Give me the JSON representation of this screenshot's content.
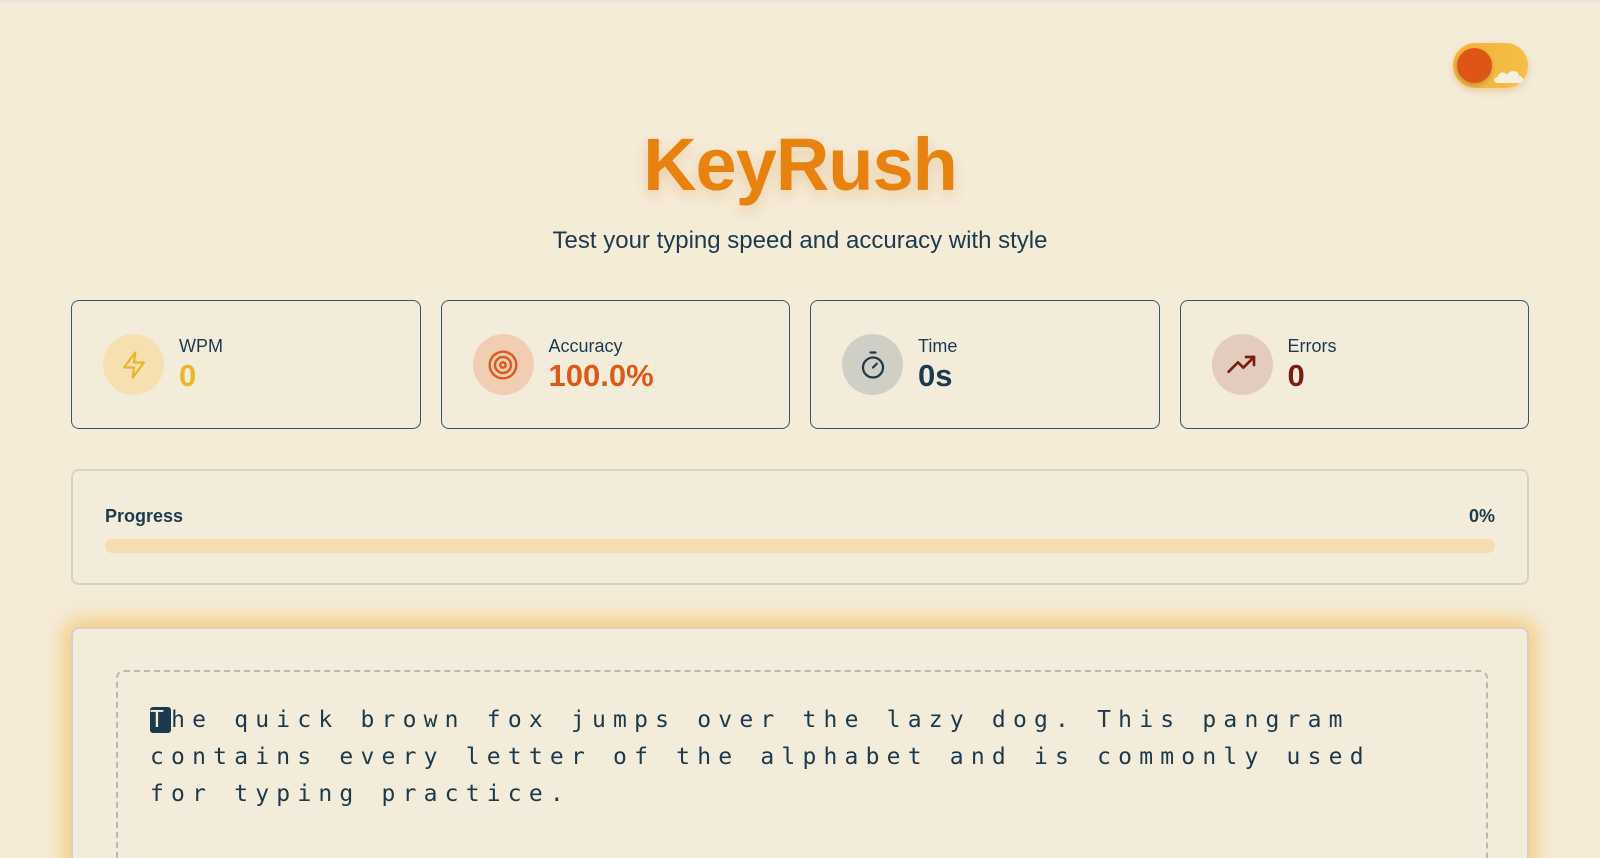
{
  "header": {
    "title": "KeyRush",
    "subtitle": "Test your typing speed and accuracy with style"
  },
  "theme_toggle": {
    "icon": "sun-cloud-toggle",
    "colors": {
      "track": "#f5c045",
      "knob": "#df5516"
    }
  },
  "stats": [
    {
      "label": "WPM",
      "value": "0",
      "icon": "lightning-icon",
      "color": "#f0b429",
      "icon_bg": "#f6e0b2"
    },
    {
      "label": "Accuracy",
      "value": "100.0%",
      "icon": "target-icon",
      "color": "#dc5a17",
      "icon_bg": "#f1cdb4"
    },
    {
      "label": "Time",
      "value": "0s",
      "icon": "stopwatch-icon",
      "color": "#1c3a4d",
      "icon_bg": "#cfcfc6"
    },
    {
      "label": "Errors",
      "value": "0",
      "icon": "trending-up-icon",
      "color": "#7a1e10",
      "icon_bg": "#e3cbbd"
    }
  ],
  "progress": {
    "label": "Progress",
    "percent_text": "0%",
    "value": 0
  },
  "typing": {
    "current_char": "T",
    "remaining_text": "he quick brown fox jumps over the lazy dog. This pangram contains every letter of the alphabet and is commonly used for typing practice."
  },
  "colors": {
    "background": "#f5ecd8",
    "accent": "#e8820f",
    "text": "#1c3a4d"
  }
}
